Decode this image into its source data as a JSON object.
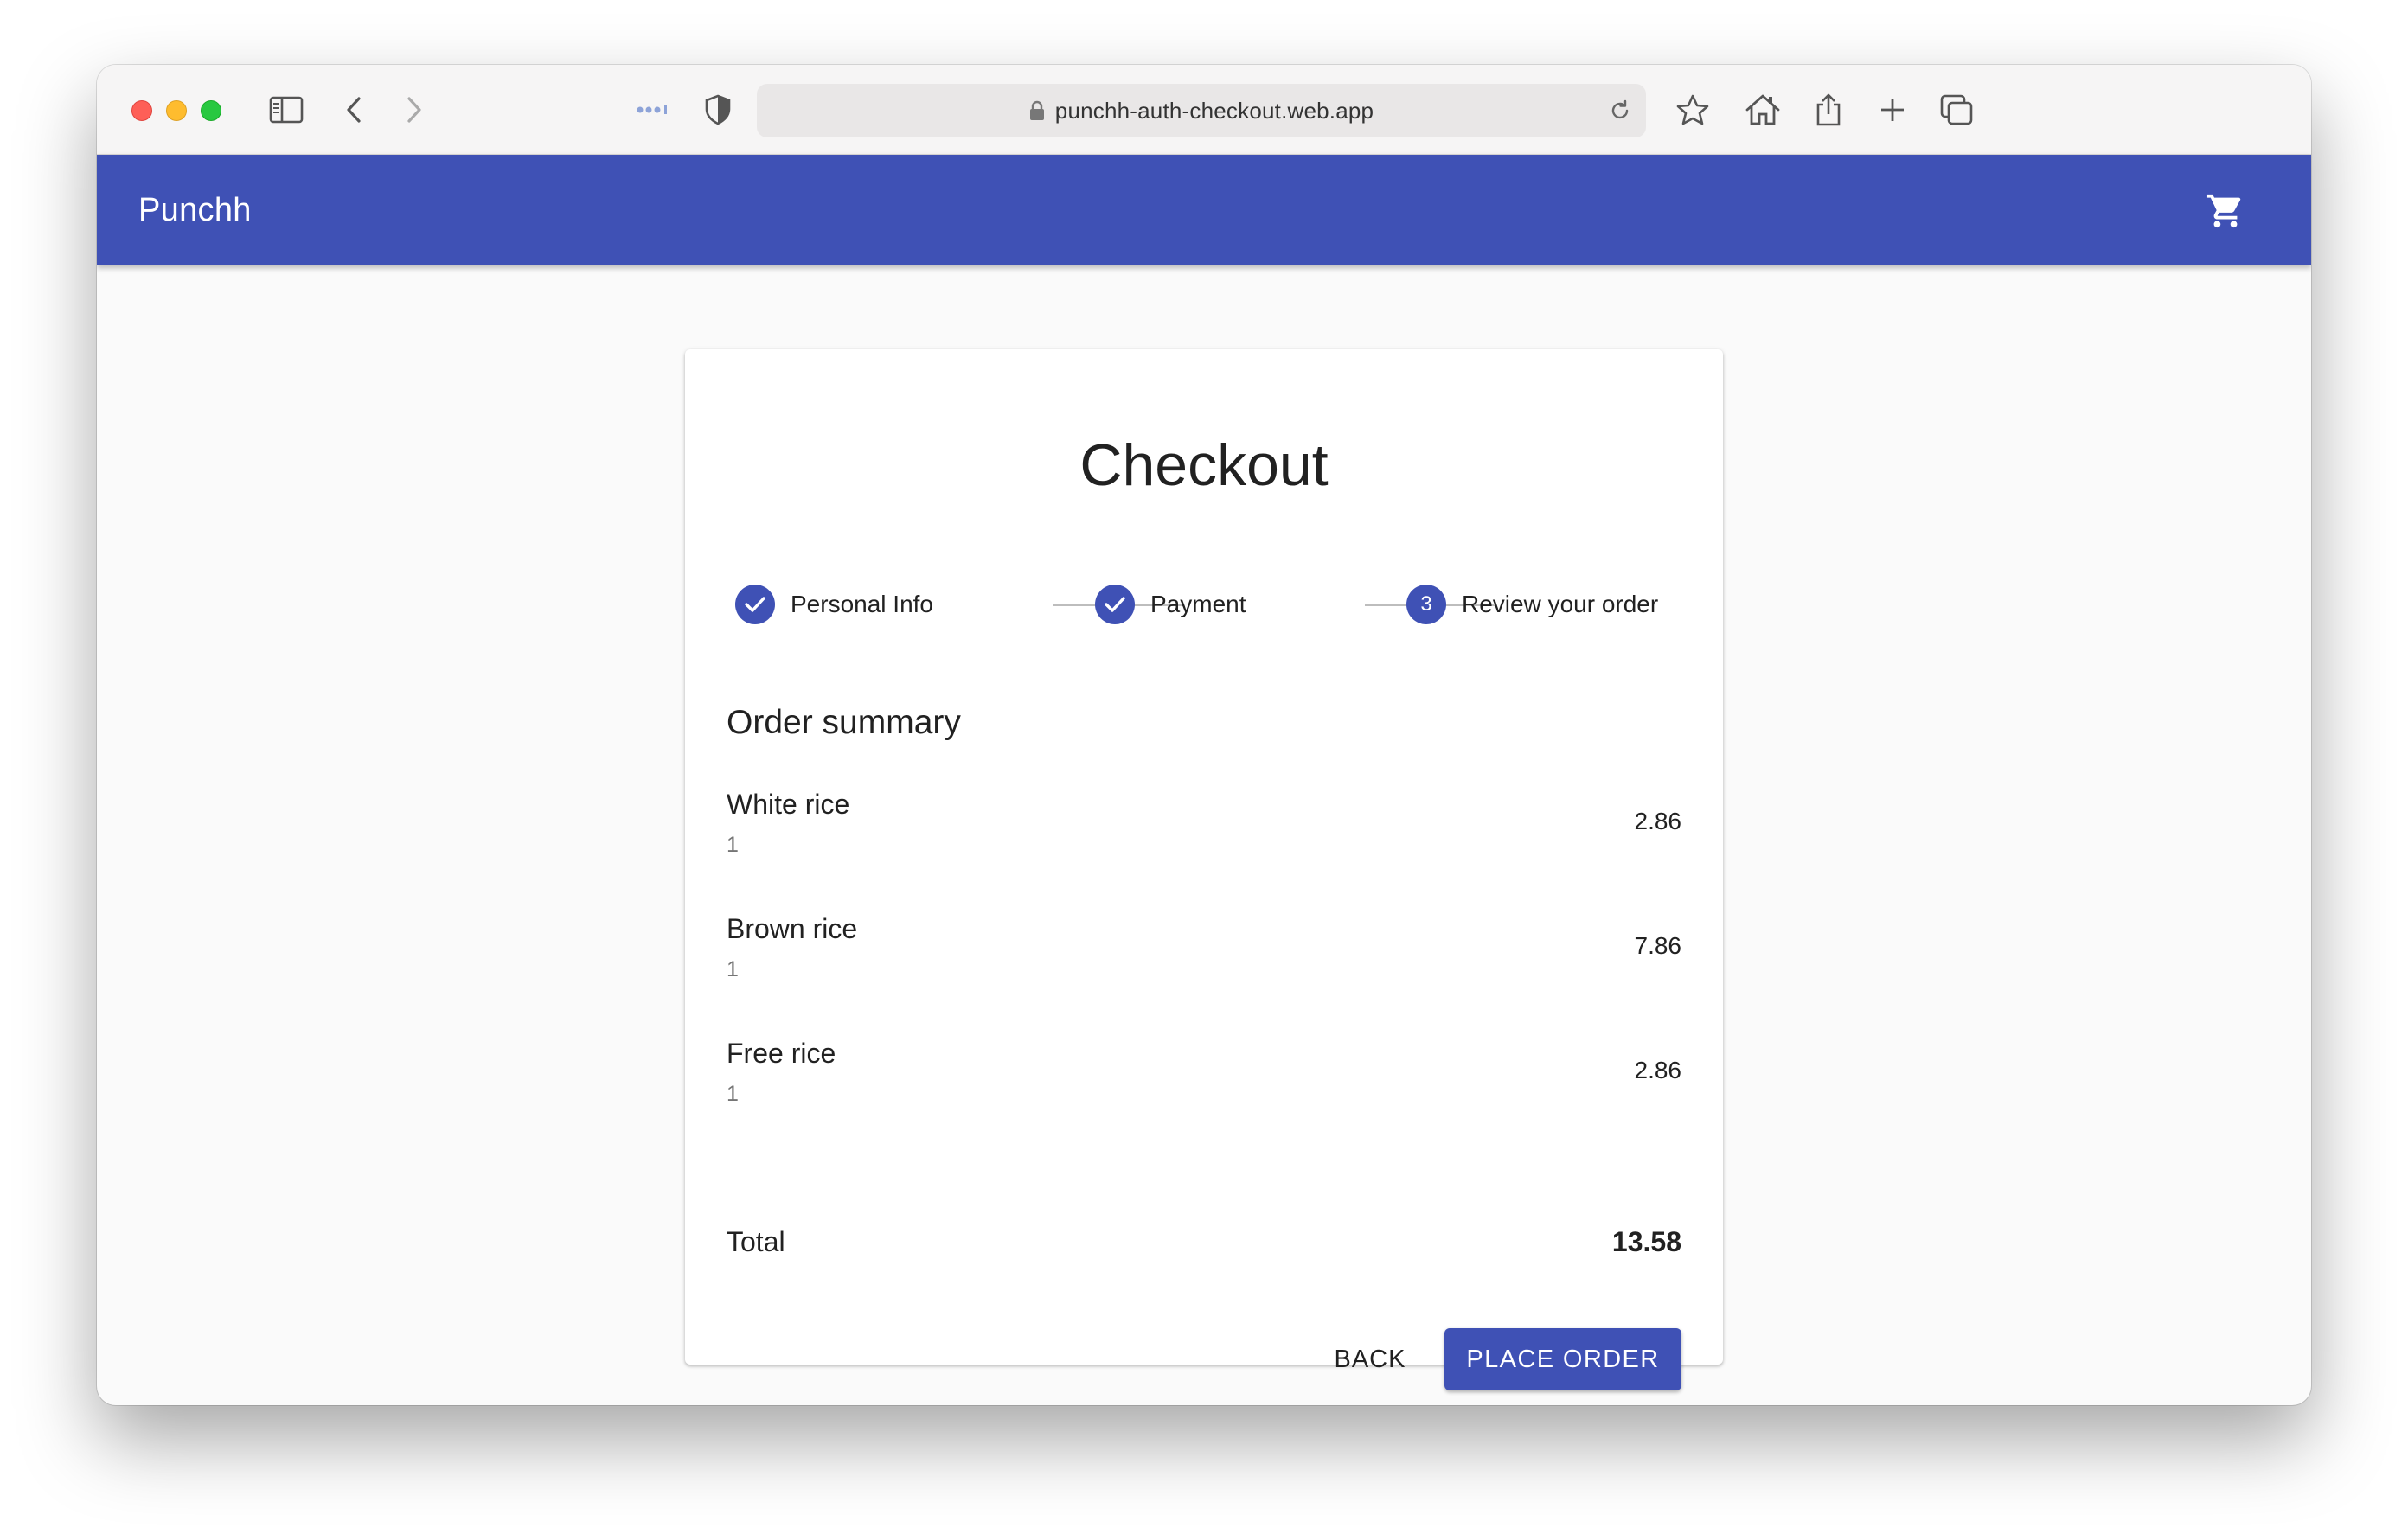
{
  "browser": {
    "url": "punchh-auth-checkout.web.app"
  },
  "app": {
    "brand": "Punchh"
  },
  "checkout": {
    "title": "Checkout",
    "steps": [
      {
        "label": "Personal Info",
        "state": "completed"
      },
      {
        "label": "Payment",
        "state": "completed"
      },
      {
        "label": "Review your order",
        "state": "active",
        "number": "3"
      }
    ],
    "summary_title": "Order summary",
    "items": [
      {
        "name": "White rice",
        "qty": "1",
        "price": "2.86"
      },
      {
        "name": "Brown rice",
        "qty": "1",
        "price": "7.86"
      },
      {
        "name": "Free rice",
        "qty": "1",
        "price": "2.86"
      }
    ],
    "total_label": "Total",
    "total_value": "13.58",
    "back_label": "BACK",
    "place_order_label": "PLACE ORDER"
  },
  "colors": {
    "primary": "#3f51b5",
    "background": "#fafafa",
    "text": "#212121",
    "secondary_text": "#757575"
  },
  "icons": {
    "sidebar": "sidebar-icon",
    "back": "chevron-left-icon",
    "forward": "chevron-right-icon",
    "extensions": "dots-icon",
    "privacy": "shield-icon",
    "lock": "lock-icon",
    "reload": "reload-icon",
    "bookmark": "star-icon",
    "home": "home-icon",
    "share": "share-icon",
    "new_tab": "plus-icon",
    "tabs": "tabs-overview-icon",
    "cart": "cart-icon",
    "step_done": "check-icon"
  }
}
